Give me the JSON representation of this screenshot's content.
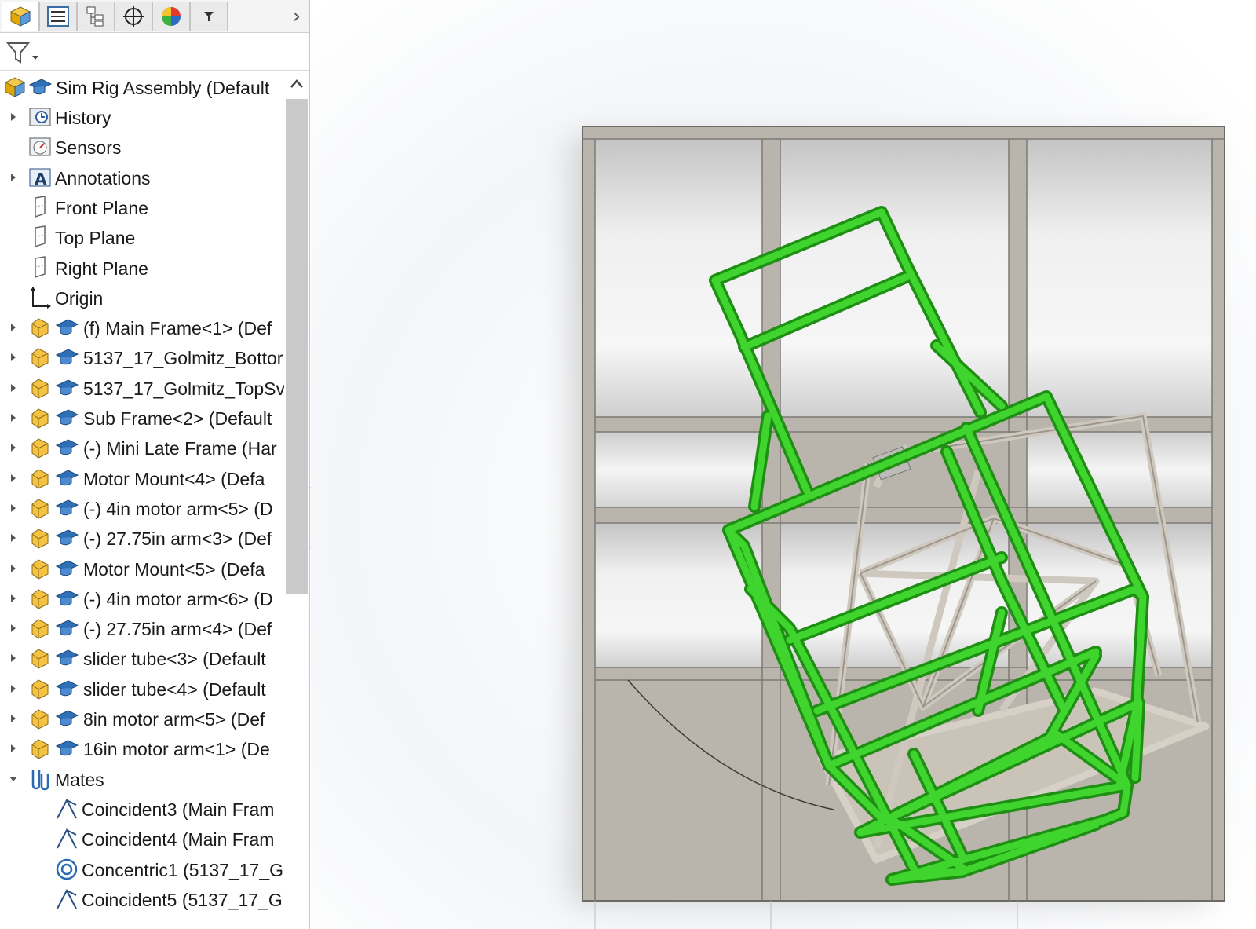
{
  "toolbar": {
    "tabs": [
      "feature-manager",
      "property-manager",
      "configuration-manager",
      "dimxpert-manager",
      "display-manager",
      "more"
    ]
  },
  "tree": {
    "root": "Sim Rig Assembly  (Default",
    "items": [
      {
        "label": "History",
        "icon": "history-icon",
        "caret": "right",
        "indent": 0
      },
      {
        "label": "Sensors",
        "icon": "sensors-icon",
        "caret": "none",
        "indent": 0
      },
      {
        "label": "Annotations",
        "icon": "annotations-icon",
        "caret": "right",
        "indent": 0
      },
      {
        "label": "Front Plane",
        "icon": "plane-icon",
        "caret": "none",
        "indent": 0
      },
      {
        "label": "Top Plane",
        "icon": "plane-icon",
        "caret": "none",
        "indent": 0
      },
      {
        "label": "Right Plane",
        "icon": "plane-icon",
        "caret": "none",
        "indent": 0
      },
      {
        "label": "Origin",
        "icon": "origin-icon",
        "caret": "none",
        "indent": 0
      },
      {
        "label": "(f) Main Frame<1> (Def",
        "icon": "component-icon",
        "caret": "right",
        "indent": 1
      },
      {
        "label": "5137_17_Golmitz_Bottor",
        "icon": "component-icon",
        "caret": "right",
        "indent": 1
      },
      {
        "label": "5137_17_Golmitz_TopSv",
        "icon": "component-icon",
        "caret": "right",
        "indent": 1
      },
      {
        "label": "Sub Frame<2> (Default",
        "icon": "component-icon",
        "caret": "right",
        "indent": 1
      },
      {
        "label": "(-) Mini Late Frame (Har",
        "icon": "component-icon",
        "caret": "right",
        "indent": 1
      },
      {
        "label": "Motor Mount<4> (Defa",
        "icon": "component-icon",
        "caret": "right",
        "indent": 1
      },
      {
        "label": "(-) 4in motor arm<5> (D",
        "icon": "component-icon",
        "caret": "right",
        "indent": 1
      },
      {
        "label": "(-) 27.75in arm<3> (Def",
        "icon": "component-icon",
        "caret": "right",
        "indent": 1
      },
      {
        "label": "Motor Mount<5> (Defa",
        "icon": "component-icon",
        "caret": "right",
        "indent": 1
      },
      {
        "label": "(-) 4in motor arm<6> (D",
        "icon": "component-icon",
        "caret": "right",
        "indent": 1
      },
      {
        "label": "(-) 27.75in arm<4> (Def",
        "icon": "component-icon",
        "caret": "right",
        "indent": 1
      },
      {
        "label": "slider tube<3> (Default",
        "icon": "component-icon",
        "caret": "right",
        "indent": 1
      },
      {
        "label": "slider tube<4> (Default",
        "icon": "component-icon",
        "caret": "right",
        "indent": 1
      },
      {
        "label": "8in motor arm<5> (Def",
        "icon": "component-icon",
        "caret": "right",
        "indent": 1
      },
      {
        "label": "16in motor arm<1> (De",
        "icon": "component-icon",
        "caret": "right",
        "indent": 1
      },
      {
        "label": "Mates",
        "icon": "mates-icon",
        "caret": "down",
        "indent": 0
      },
      {
        "label": "Coincident3 (Main Fram",
        "icon": "coincident-mate-icon",
        "caret": "none",
        "indent": 2
      },
      {
        "label": "Coincident4 (Main Fram",
        "icon": "coincident-mate-icon",
        "caret": "none",
        "indent": 2
      },
      {
        "label": "Concentric1 (5137_17_G",
        "icon": "concentric-mate-icon",
        "caret": "none",
        "indent": 2
      },
      {
        "label": "Coincident5 (5137_17_G",
        "icon": "coincident-mate-icon",
        "caret": "none",
        "indent": 2
      }
    ]
  },
  "colors": {
    "frame_green": "#2bb51f",
    "tube_grey": "#c9c2b8",
    "panel_grey": "#b9b4ac"
  }
}
